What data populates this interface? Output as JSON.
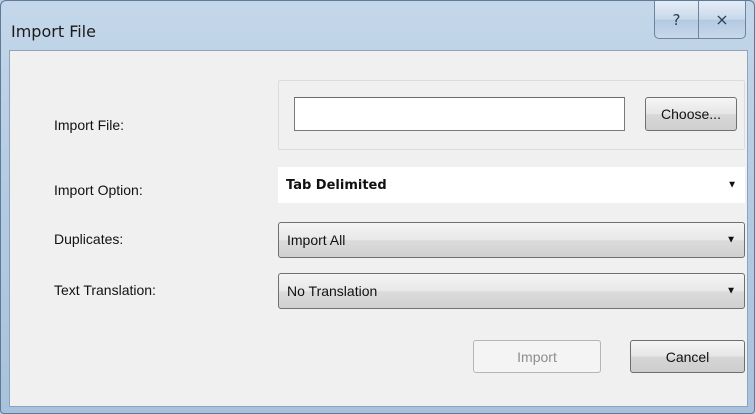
{
  "window": {
    "title": "Import File",
    "help_label": "?",
    "close_label": "⨯"
  },
  "form": {
    "import_file_label": "Import File:",
    "file_value": "",
    "choose_label": "Choose...",
    "import_option_label": "Import Option:",
    "import_option_value": "Tab Delimited",
    "duplicates_label": "Duplicates:",
    "duplicates_value": "Import All",
    "text_translation_label": "Text Translation:",
    "text_translation_value": "No Translation"
  },
  "buttons": {
    "import_label": "Import",
    "cancel_label": "Cancel"
  }
}
